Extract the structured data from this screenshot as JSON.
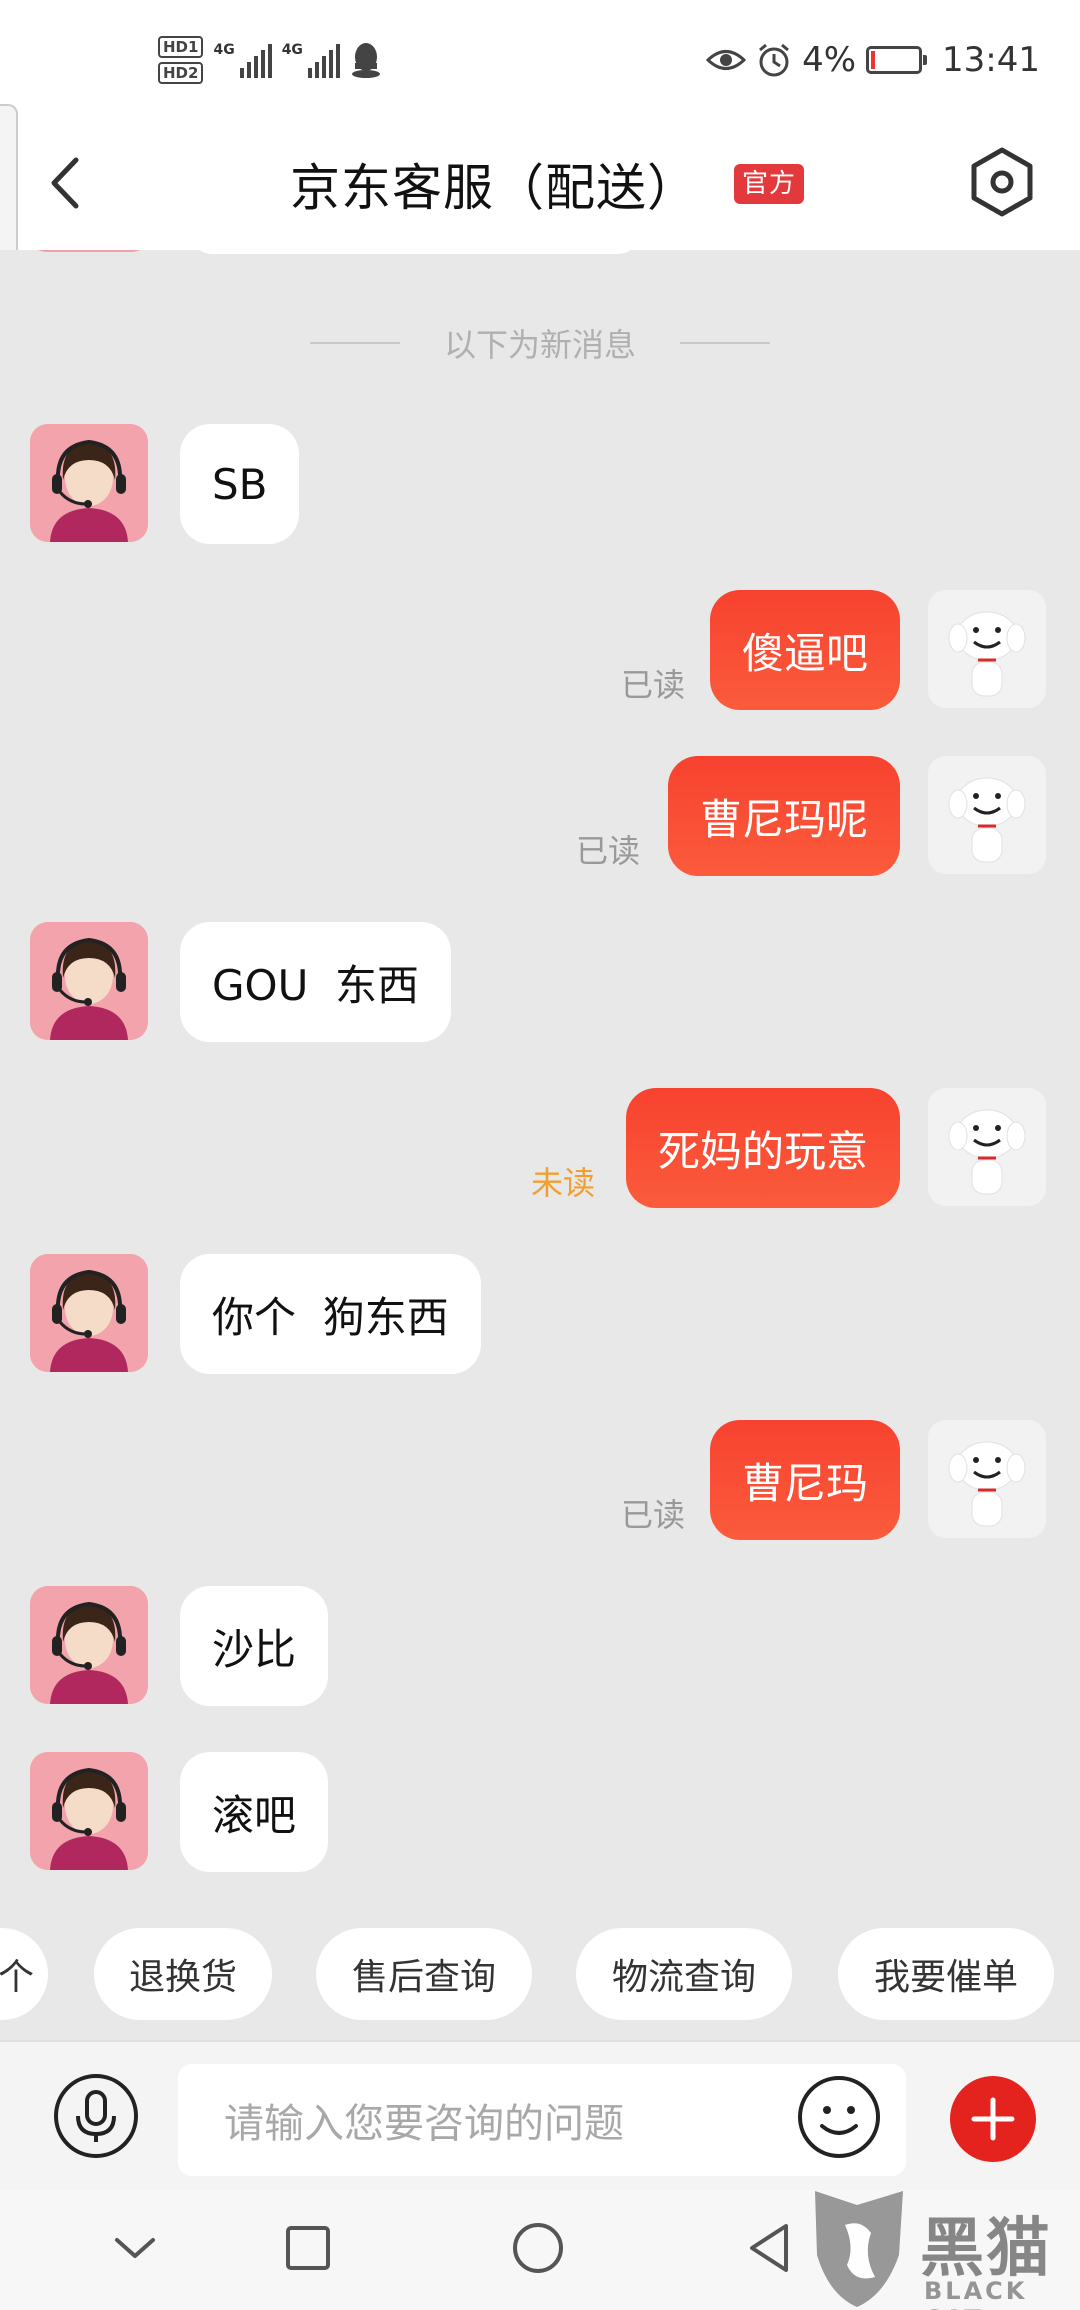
{
  "status_bar": {
    "hd1": "HD1",
    "hd2": "HD2",
    "net1": "4G",
    "net2": "4G",
    "battery": "4%",
    "time": "13:41",
    "battery_level": 0.04,
    "icons": [
      "eye-icon",
      "alarm-icon",
      "battery-icon",
      "qq-icon"
    ]
  },
  "header": {
    "title": "京东客服（配送）",
    "badge": "官方",
    "accent": "#e4393c"
  },
  "chat": {
    "divider": "以下为新消息",
    "messages": [
      {
        "from": "agent",
        "text": "SB"
      },
      {
        "from": "user",
        "text": "傻逼吧",
        "status": "已读"
      },
      {
        "from": "user",
        "text": "曹尼玛呢",
        "status": "已读"
      },
      {
        "from": "agent",
        "text": "GOU  东西"
      },
      {
        "from": "user",
        "text": "死妈的玩意",
        "status": "未读"
      },
      {
        "from": "agent",
        "text": "你个  狗东西"
      },
      {
        "from": "user",
        "text": "曹尼玛",
        "status": "已读"
      },
      {
        "from": "agent",
        "text": "沙比"
      },
      {
        "from": "agent",
        "text": "滚吧"
      }
    ],
    "colors": {
      "outgoing": "#f7422f",
      "read_status": "#999999",
      "unread_status": "#f0a030"
    }
  },
  "quick_replies": [
    "个",
    "退换货",
    "售后查询",
    "物流查询",
    "我要催单"
  ],
  "input": {
    "placeholder": "请输入您要咨询的问题",
    "plus_color": "#e4231e"
  },
  "watermark": {
    "cn": "黑猫",
    "en": "BLACK CAT"
  }
}
